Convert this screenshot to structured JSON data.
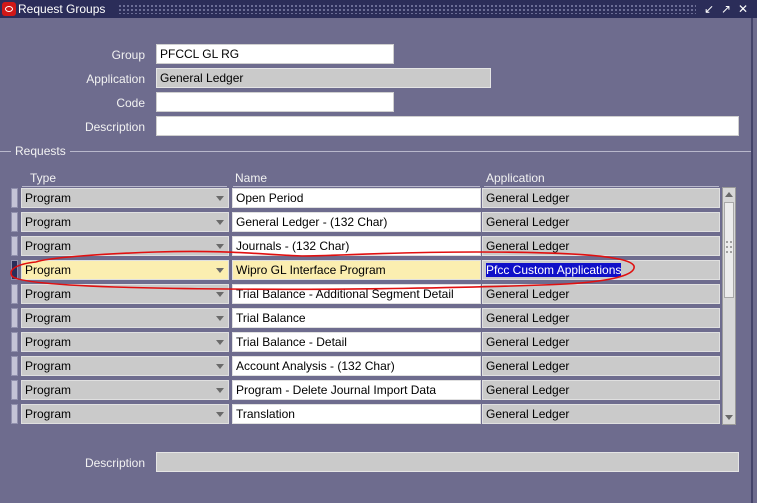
{
  "window": {
    "title": "Request Groups",
    "controls": [
      "restore-down-icon",
      "maximize-icon",
      "close-icon"
    ]
  },
  "form": {
    "group_label": "Group",
    "group_value": "PFCCL GL RG",
    "application_label": "Application",
    "application_value": "General Ledger",
    "code_label": "Code",
    "code_value": "",
    "description_label": "Description",
    "description_value": ""
  },
  "requests": {
    "section_label": "Requests",
    "columns": [
      "Type",
      "Name",
      "Application"
    ],
    "rows": [
      {
        "type": "Program",
        "name": "Open Period",
        "application": "General Ledger"
      },
      {
        "type": "Program",
        "name": "General Ledger - (132 Char)",
        "application": "General Ledger"
      },
      {
        "type": "Program",
        "name": "Journals - (132 Char)",
        "application": "General Ledger"
      },
      {
        "type": "Program",
        "name": "Wipro GL Interface Program",
        "application": "Pfcc Custom Applications"
      },
      {
        "type": "Program",
        "name": "Trial Balance - Additional Segment Detail",
        "application": "General Ledger"
      },
      {
        "type": "Program",
        "name": "Trial Balance",
        "application": "General Ledger"
      },
      {
        "type": "Program",
        "name": "Trial Balance - Detail",
        "application": "General Ledger"
      },
      {
        "type": "Program",
        "name": "Account Analysis - (132 Char)",
        "application": "General Ledger"
      },
      {
        "type": "Program",
        "name": "Program - Delete Journal Import Data",
        "application": "General Ledger"
      },
      {
        "type": "Program",
        "name": "Translation",
        "application": "General Ledger"
      }
    ],
    "current_row": 4
  },
  "footer": {
    "description_label": "Description",
    "description_value": ""
  },
  "colors": {
    "background": "#6e6c8e",
    "titlebar": "#2b2d59",
    "current_record": "#fbeeb0",
    "selection": "#1010c8",
    "annotation": "#e01010"
  }
}
